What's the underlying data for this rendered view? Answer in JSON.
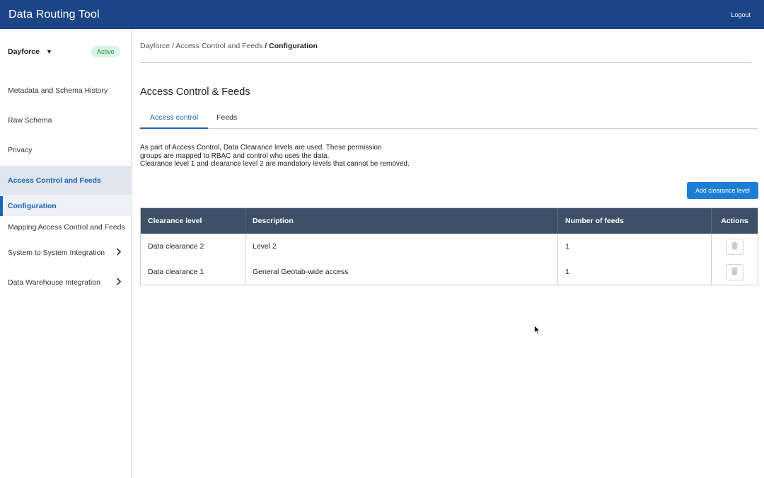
{
  "app": {
    "title": "Data Routing Tool",
    "logout_label": "Logout"
  },
  "sidebar": {
    "tenant": {
      "name": "Dayforce",
      "status": "Active"
    },
    "items": [
      {
        "label": "Metadata and Schema History"
      },
      {
        "label": "Raw Schema"
      },
      {
        "label": "Privacy"
      },
      {
        "label": "Access Control and Feeds"
      },
      {
        "label": "Configuration"
      },
      {
        "label": "Mapping Access Control and Feeds"
      },
      {
        "label": "System to System Integration"
      },
      {
        "label": "Data Warehouse Integration"
      }
    ],
    "active_item": "Access Control and Feeds",
    "active_subitem": "Configuration"
  },
  "breadcrumb": {
    "part1": "Dayforce",
    "part2": "Access Control and Feeds",
    "current": "Configuration"
  },
  "main": {
    "title": "Access Control & Feeds",
    "tabs": [
      {
        "label": "Access control"
      },
      {
        "label": "Feeds"
      }
    ],
    "active_tab": "Access control",
    "description": [
      "As part of Access Control, Data Clearance levels are used. These permission",
      "groups are mapped to RBAC and control who uses the data.",
      "Clearance level 1 and clearance level 2 are mandatory levels that cannot be removed."
    ],
    "add_button_label": "Add clearance level",
    "table": {
      "headers": [
        "Clearance level",
        "Description",
        "Number of feeds",
        "Actions"
      ],
      "rows": [
        {
          "level": "Data clearance 2",
          "description": "Level 2",
          "feeds": "1"
        },
        {
          "level": "Data clearance 1",
          "description": "General Geotab-wide access",
          "feeds": "1"
        }
      ]
    }
  },
  "colors": {
    "topbar": "#1c4587",
    "accent": "#1a66b8",
    "button": "#1b7ed4",
    "table_header": "#3d5067",
    "badge_bg": "#d9f5e2",
    "badge_text": "#1f8a4c"
  },
  "icons": [
    "caret-down-icon",
    "chevron-right-icon",
    "trash-icon",
    "mouse-cursor-icon"
  ]
}
